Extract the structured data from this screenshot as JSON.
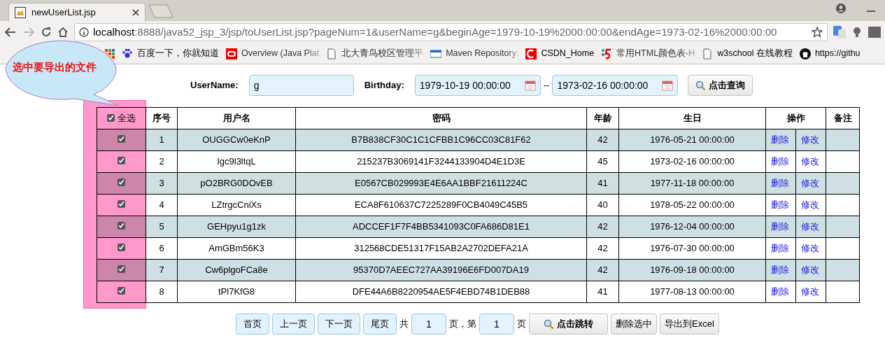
{
  "browser": {
    "tab_title": "newUserList.jsp",
    "url_host": "localhost",
    "url_rest": ":8888/java52_jsp_3/jsp/toUserList.jsp?pageNum=1&userName=g&beginAge=1979-10-19%2000:00:00&endAge=1973-02-16%2000:00:00",
    "bookmarks": [
      {
        "kind": "paw",
        "label": "百度一下，你就知道",
        "faded": false
      },
      {
        "kind": "oracle",
        "label": "Overview (Java Plat",
        "faded": true
      },
      {
        "kind": "page",
        "label": "北大青鸟校区管理平",
        "faded": true
      },
      {
        "kind": "maven",
        "label": "Maven Repository:",
        "faded": true
      },
      {
        "kind": "csdn",
        "label": "CSDN_Home",
        "faded": false
      },
      {
        "kind": "colors",
        "label": "常用HTML颜色表-H",
        "faded": true
      },
      {
        "kind": "page",
        "label": "w3school 在线教程",
        "faded": false
      },
      {
        "kind": "github",
        "label": "https://githu",
        "faded": false
      }
    ]
  },
  "callout": {
    "text": "选中要导出的文件"
  },
  "search": {
    "username_label": "UserName:",
    "username_value": "g",
    "birthday_label": "Birthday:",
    "begin_value": "1979-10-19 00:00:00",
    "separator": "--",
    "end_value": "1973-02-16 00:00:00",
    "button": "点击查询"
  },
  "table": {
    "select_all": {
      "label": "全选",
      "checked": true
    },
    "columns": [
      "序号",
      "用户名",
      "密码",
      "年龄",
      "生日",
      "操作",
      "备注"
    ],
    "rows": [
      {
        "checked": true,
        "no": "1",
        "username": "OUGGCw0eKnP",
        "password": "B7B838CF30C1C1CFBB1C96CC03C81F62",
        "age": "42",
        "birthday": "1976-05-21 00:00:00",
        "delete": "删除",
        "edit": "修改"
      },
      {
        "checked": true,
        "no": "2",
        "username": "Igc9l3ltqL",
        "password": "215237B3069141F3244133904D4E1D3E",
        "age": "45",
        "birthday": "1973-02-16 00:00:00",
        "delete": "删除",
        "edit": "修改"
      },
      {
        "checked": true,
        "no": "3",
        "username": "pO2BRG0DOvEB",
        "password": "E0567CB029993E4E6AA1BBF21611224C",
        "age": "41",
        "birthday": "1977-11-18 00:00:00",
        "delete": "删除",
        "edit": "修改"
      },
      {
        "checked": true,
        "no": "4",
        "username": "LZtrgcCniXs",
        "password": "ECA8F610637C7225289F0CB4049C45B5",
        "age": "40",
        "birthday": "1978-05-22 00:00:00",
        "delete": "删除",
        "edit": "修改"
      },
      {
        "checked": true,
        "no": "5",
        "username": "GEHpyu1g1zk",
        "password": "ADCCEF1F7F4BB5341093C0FA686D81E1",
        "age": "42",
        "birthday": "1976-12-04 00:00:00",
        "delete": "删除",
        "edit": "修改"
      },
      {
        "checked": true,
        "no": "6",
        "username": "AmGBm56K3",
        "password": "312568CDE51317F15AB2A2702DEFA21A",
        "age": "42",
        "birthday": "1976-07-30 00:00:00",
        "delete": "删除",
        "edit": "修改"
      },
      {
        "checked": true,
        "no": "7",
        "username": "Cw6plgoFCa8e",
        "password": "95370D7AEEC727AA39196E6FD007DA19",
        "age": "42",
        "birthday": "1976-09-18 00:00:00",
        "delete": "删除",
        "edit": "修改"
      },
      {
        "checked": true,
        "no": "8",
        "username": "tPl7KfG8",
        "password": "DFE44A6B8220954AE5F4EBD74B1DEB88",
        "age": "41",
        "birthday": "1977-08-13 00:00:00",
        "delete": "删除",
        "edit": "修改"
      }
    ]
  },
  "pagination": {
    "first": "首页",
    "prev": "上一页",
    "next": "下一页",
    "last": "尾页",
    "total_prefix": "共",
    "total_value": "1",
    "total_suffix": "页，第",
    "page_value": "1",
    "page_suffix": "页",
    "jump_button": "点击跳转",
    "delete_selected": "删除选中",
    "export": "导出到Excel"
  }
}
